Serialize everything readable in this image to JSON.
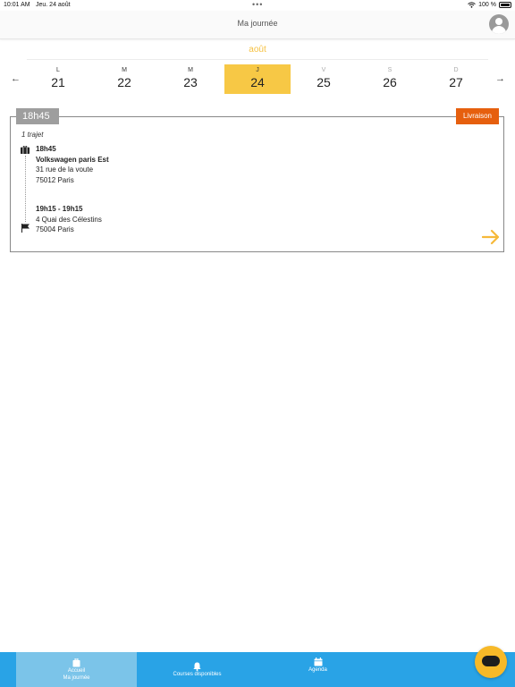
{
  "status_bar": {
    "time": "10:01 AM",
    "date": "Jeu. 24 août",
    "battery": "100 %"
  },
  "header": {
    "title": "Ma journée",
    "avatar_icon": "user-icon"
  },
  "calendar": {
    "month": "août",
    "days": [
      {
        "letter": "L",
        "number": "21"
      },
      {
        "letter": "M",
        "number": "22"
      },
      {
        "letter": "M",
        "number": "23"
      },
      {
        "letter": "J",
        "number": "24"
      },
      {
        "letter": "V",
        "number": "25"
      },
      {
        "letter": "S",
        "number": "26"
      },
      {
        "letter": "D",
        "number": "27"
      }
    ],
    "selected_index": 3,
    "prev_arrow": "←",
    "next_arrow": "→"
  },
  "delivery": {
    "time": "18h45",
    "type": "Livraison",
    "trip_count": "1 trajet",
    "pickup": {
      "time": "18h45",
      "name": "Volkswagen paris Est",
      "street": "31 rue de la voute",
      "city": "75012 Paris"
    },
    "dropoff": {
      "time": "19h15 - 19h15",
      "street": "4 Quai des Célestins",
      "city": "75004 Paris"
    }
  },
  "tabs": [
    {
      "label_line1": "Accueil",
      "label_line2": "Ma journée",
      "icon": "briefcase-icon",
      "active": true
    },
    {
      "label_line1": "Courses disponibles",
      "icon": "bell-icon",
      "active": false
    },
    {
      "label_line1": "Agenda",
      "icon": "calendar-icon",
      "active": false
    }
  ],
  "colors": {
    "accent_yellow": "#f7c845",
    "month_yellow": "#f6c244",
    "delivery_orange": "#e65f0e",
    "time_gray": "#9e9e9e",
    "tab_blue": "#29a3e6",
    "tab_active": "#7bc4e9",
    "chat_yellow": "#f7b928"
  }
}
